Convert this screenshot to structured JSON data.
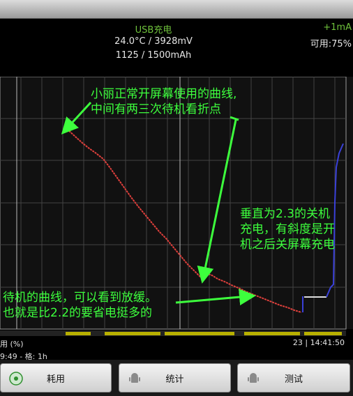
{
  "status": {
    "title": "USB充电",
    "temp_voltage": "24.0°C / 3928mV",
    "capacity": "1125 / 1500mAh",
    "current": "+1mA",
    "available": "可用:75%"
  },
  "graph": {
    "legend_left": "用 (%)",
    "legend_right": "23 | 14:41:50",
    "annotations": {
      "top_line1": "小丽正常开屏幕使用的曲线,",
      "top_line2": "中间有两三次待机看折点",
      "right_line1": "垂直为2.3的关机",
      "right_line2": "充电，有斜度是开",
      "right_line3": "机之后关屏幕充电",
      "bottom_line1": "待机的曲线，可以看到放缓。",
      "bottom_line2": "也就是比2.2的要省电挺多的"
    }
  },
  "info_bar": "9:49 - 格: 1h",
  "buttons": {
    "usage": "耗用",
    "stats": "统计",
    "test": "测试"
  },
  "colors": {
    "curve_discharge": "#e0403c",
    "curve_charge": "#3a40d8",
    "annotation": "#3dff3d",
    "timeline": "#b8b000"
  }
}
